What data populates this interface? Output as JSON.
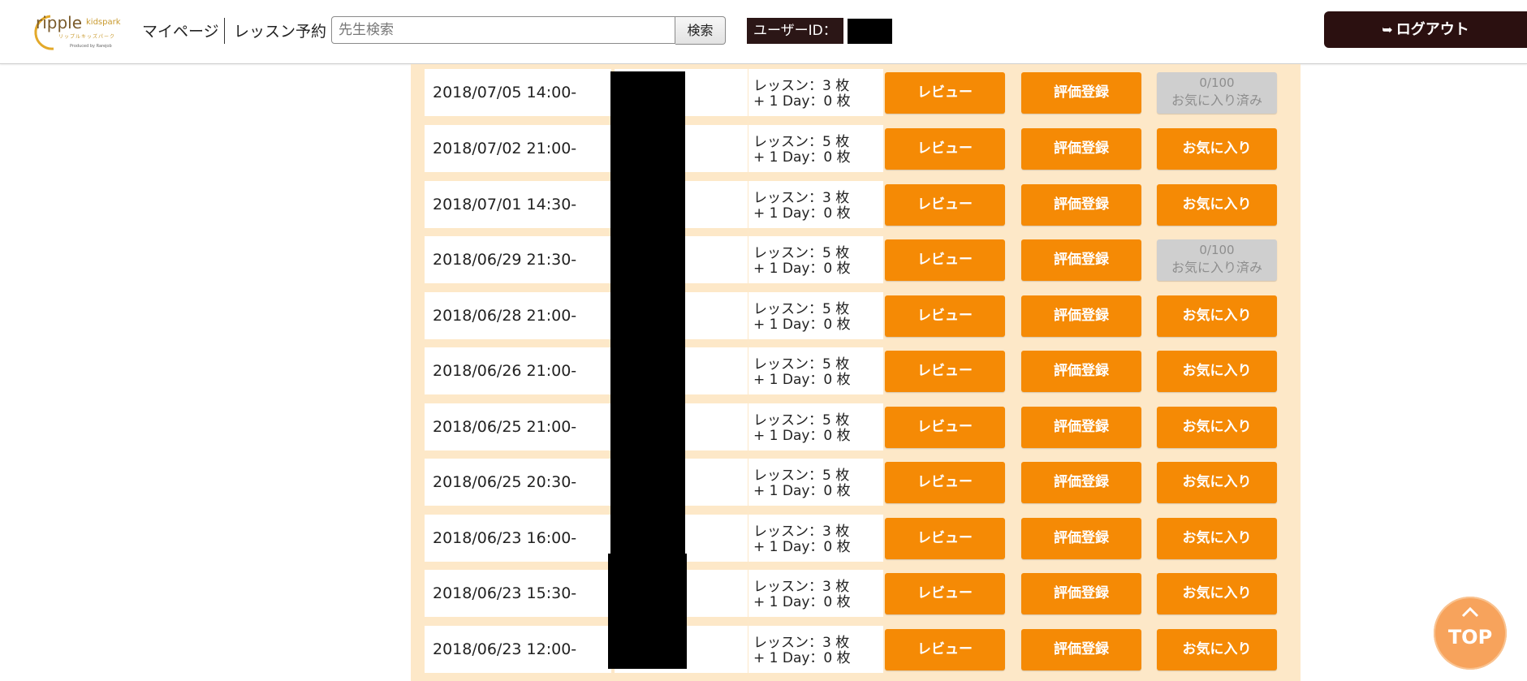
{
  "header": {
    "logo_text": "ripple",
    "logo_sub": "kidspark",
    "logo_kana": "リップルキッズパーク",
    "logo_producer": "Produced by Rarejob",
    "nav": [
      "マイページ",
      "レッスン予約"
    ],
    "search_placeholder": "先生検索",
    "search_button": "検索",
    "userid_label": "ユーザーID：",
    "logout_label": "ログアウト"
  },
  "rows": [
    {
      "date": "2018/07/05 14:00-",
      "tickets_line1": "レッスン：3 枚",
      "tickets_line2": "+ 1 Day：0 枚",
      "review": "レビュー",
      "evaluate": "評価登録",
      "fav_state": "done",
      "fav_count": "0/100",
      "fav_label": "お気に入り済み"
    },
    {
      "date": "2018/07/02 21:00-",
      "tickets_line1": "レッスン：5 枚",
      "tickets_line2": "+ 1 Day：0 枚",
      "review": "レビュー",
      "evaluate": "評価登録",
      "fav_state": "add",
      "fav_label": "お気に入り"
    },
    {
      "date": "2018/07/01 14:30-",
      "tickets_line1": "レッスン：3 枚",
      "tickets_line2": "+ 1 Day：0 枚",
      "review": "レビュー",
      "evaluate": "評価登録",
      "fav_state": "add",
      "fav_label": "お気に入り"
    },
    {
      "date": "2018/06/29 21:30-",
      "tickets_line1": "レッスン：5 枚",
      "tickets_line2": "+ 1 Day：0 枚",
      "review": "レビュー",
      "evaluate": "評価登録",
      "fav_state": "done",
      "fav_count": "0/100",
      "fav_label": "お気に入り済み"
    },
    {
      "date": "2018/06/28 21:00-",
      "tickets_line1": "レッスン：5 枚",
      "tickets_line2": "+ 1 Day：0 枚",
      "review": "レビュー",
      "evaluate": "評価登録",
      "fav_state": "add",
      "fav_label": "お気に入り"
    },
    {
      "date": "2018/06/26 21:00-",
      "tickets_line1": "レッスン：5 枚",
      "tickets_line2": "+ 1 Day：0 枚",
      "review": "レビュー",
      "evaluate": "評価登録",
      "fav_state": "add",
      "fav_label": "お気に入り"
    },
    {
      "date": "2018/06/25 21:00-",
      "tickets_line1": "レッスン：5 枚",
      "tickets_line2": "+ 1 Day：0 枚",
      "review": "レビュー",
      "evaluate": "評価登録",
      "fav_state": "add",
      "fav_label": "お気に入り"
    },
    {
      "date": "2018/06/25 20:30-",
      "tickets_line1": "レッスン：5 枚",
      "tickets_line2": "+ 1 Day：0 枚",
      "review": "レビュー",
      "evaluate": "評価登録",
      "fav_state": "add",
      "fav_label": "お気に入り"
    },
    {
      "date": "2018/06/23 16:00-",
      "tickets_line1": "レッスン：3 枚",
      "tickets_line2": "+ 1 Day：0 枚",
      "review": "レビュー",
      "evaluate": "評価登録",
      "fav_state": "add",
      "fav_label": "お気に入り"
    },
    {
      "date": "2018/06/23 15:30-",
      "tickets_line1": "レッスン：3 枚",
      "tickets_line2": "+ 1 Day：0 枚",
      "review": "レビュー",
      "evaluate": "評価登録",
      "fav_state": "add",
      "fav_label": "お気に入り"
    },
    {
      "date": "2018/06/23 12:00-",
      "tickets_line1": "レッスン：3 枚",
      "tickets_line2": "+ 1 Day：0 枚",
      "review": "レビュー",
      "evaluate": "評価登録",
      "fav_state": "add",
      "fav_label": "お気に入り"
    }
  ],
  "top_button": "TOP",
  "colors": {
    "accent": "#f58a05",
    "panel": "#fde8c8",
    "header_dark": "#2b1010",
    "disabled": "#cfcfcf"
  }
}
